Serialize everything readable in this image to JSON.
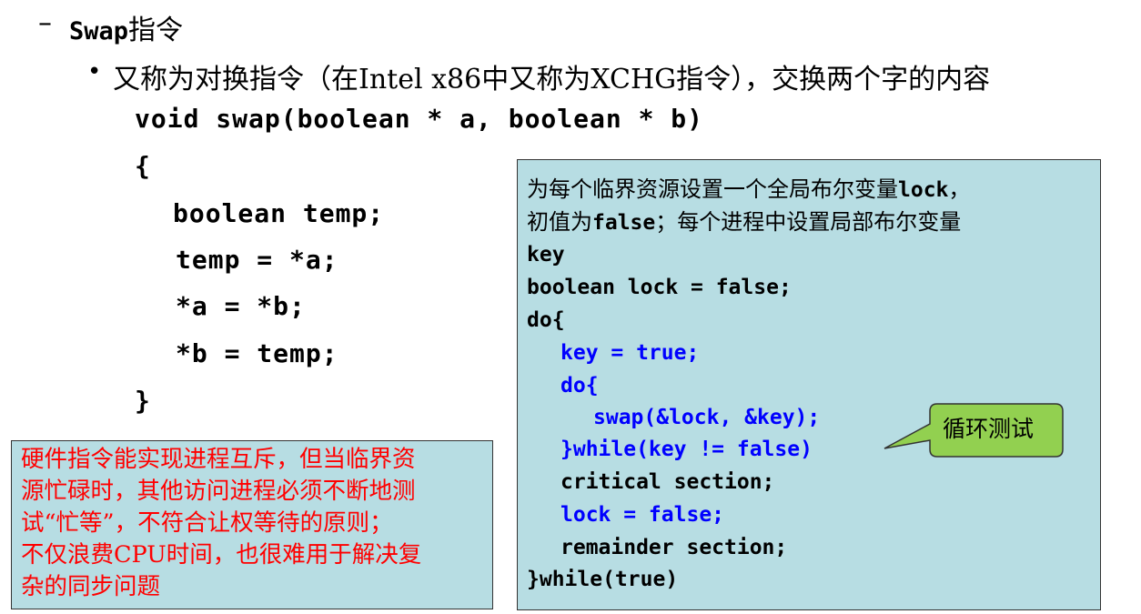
{
  "heading": {
    "dash": "–",
    "swap_word": "Swap",
    "suffix": "指令"
  },
  "subpoint": {
    "bullet": "•",
    "text": "又称为对换指令（在Intel x86中又称为XCHG指令），交换两个字的内容"
  },
  "code": {
    "lines": [
      "void swap(boolean * a, boolean * b)",
      "{",
      "boolean temp;",
      "temp = *a;",
      "*a = *b;",
      "*b = temp;",
      "}"
    ]
  },
  "note": {
    "lines": [
      "硬件指令能实现进程互斥，但当临界资",
      "源忙碌时，其他访问进程必须不断地测",
      "试“忙等”，不符合让权等待的原则；",
      "不仅浪费CPU时间，也很难用于解决复",
      "杂的同步问题"
    ],
    "color": "#ff0000"
  },
  "lockbox": {
    "desc_a": "为每个临界资源设置一个全局布尔变量",
    "desc_lock": "lock",
    "desc_comma": "，",
    "desc_b": "初值为",
    "desc_false": "false",
    "desc_c": "；每个进程中设置局部布尔变量",
    "desc_key": "key",
    "code": [
      "boolean lock = false;",
      "do{",
      "key = true;",
      "do{",
      "swap(&lock, &key);",
      "}while(key != false)",
      "critical section;",
      "lock = false;",
      "remainder section;",
      "}while(true)"
    ],
    "bg_color": "#b7dde3",
    "highlight_color": "#0000ff"
  },
  "callout": {
    "text": "循环测试",
    "fill": "#92d050"
  }
}
